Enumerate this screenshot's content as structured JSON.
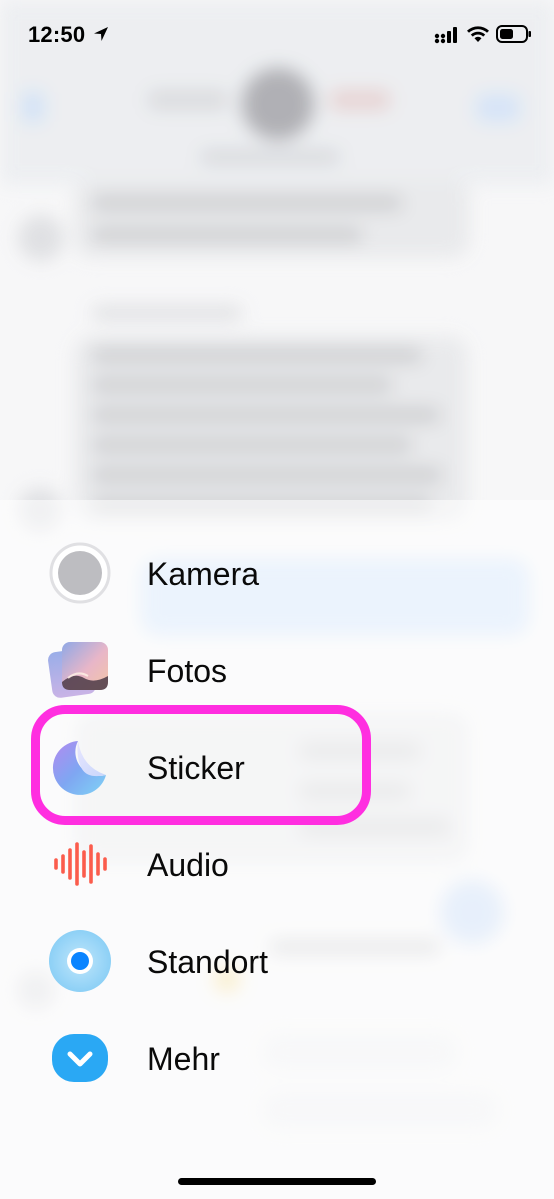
{
  "status_bar": {
    "time": "12:50",
    "location_icon": "location-arrow-icon",
    "signal_icon": "cellular-signal-icon",
    "wifi_icon": "wifi-icon",
    "battery_icon": "battery-icon"
  },
  "menu": {
    "items": [
      {
        "label": "Kamera",
        "icon": "camera-icon"
      },
      {
        "label": "Fotos",
        "icon": "photos-icon"
      },
      {
        "label": "Sticker",
        "icon": "sticker-icon"
      },
      {
        "label": "Audio",
        "icon": "audio-waveform-icon"
      },
      {
        "label": "Standort",
        "icon": "location-pin-icon"
      },
      {
        "label": "Mehr",
        "icon": "chevron-down-icon"
      }
    ]
  },
  "colors": {
    "highlight": "#ff2ee0",
    "audio": "#fb5c4c",
    "mehr": "#2aa8f4",
    "standort": "#0a84ff"
  }
}
